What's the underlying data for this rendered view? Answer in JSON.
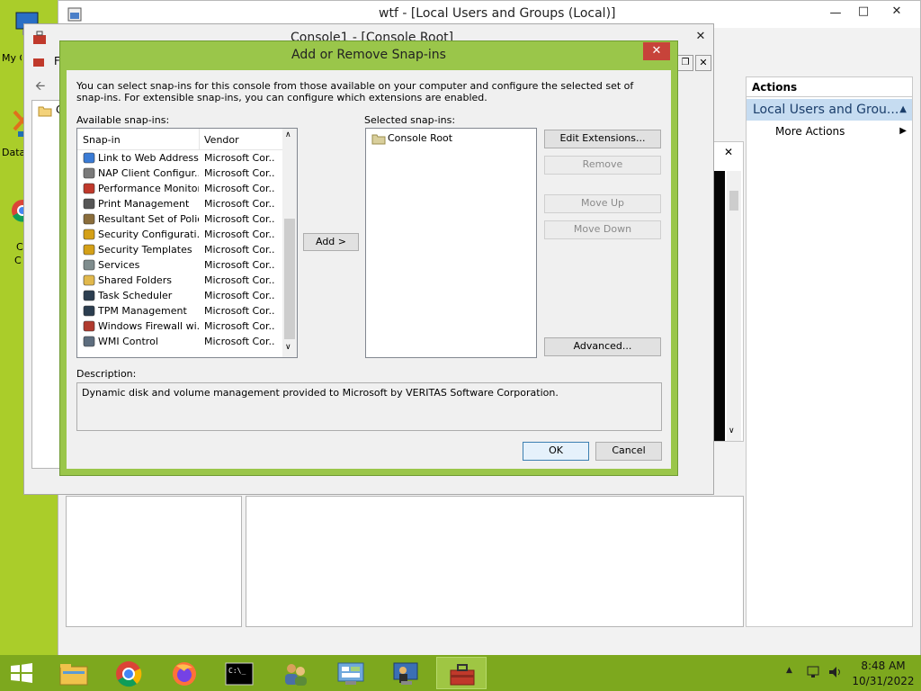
{
  "desktop": {
    "icons": [
      {
        "label": "My C",
        "icon": "computer-icon"
      },
      {
        "label": "Data",
        "icon": "tools-icon"
      },
      {
        "label": "C",
        "icon": "chrome-icon"
      },
      {
        "label": "C",
        "icon": "chrome-icon"
      }
    ]
  },
  "main_window": {
    "title": "wtf - [Local Users and Groups (Local)]",
    "actions_header": "Actions",
    "actions_section": "Local Users and Grou...",
    "more_actions": "More Actions"
  },
  "console_window": {
    "title": "Console1 - [Console Root]",
    "partial_menu": "F",
    "partial_tree": "C"
  },
  "dialog": {
    "title": "Add or Remove Snap-ins",
    "intro": "You can select snap-ins for this console from those available on your computer and configure the selected set of snap-ins. For extensible snap-ins, you can configure which extensions are enabled.",
    "available_label": "Available snap-ins:",
    "selected_label": "Selected snap-ins:",
    "columns": {
      "snapin": "Snap-in",
      "vendor": "Vendor"
    },
    "available": [
      {
        "name": "Link to Web Address",
        "vendor": "Microsoft Cor...",
        "icon": "link-icon"
      },
      {
        "name": "NAP Client Configur...",
        "vendor": "Microsoft Cor...",
        "icon": "nap-client-icon"
      },
      {
        "name": "Performance Monitor",
        "vendor": "Microsoft Cor...",
        "icon": "performance-monitor-icon"
      },
      {
        "name": "Print Management",
        "vendor": "Microsoft Cor...",
        "icon": "printer-icon"
      },
      {
        "name": "Resultant Set of Policy",
        "vendor": "Microsoft Cor...",
        "icon": "policy-icon"
      },
      {
        "name": "Security Configurati...",
        "vendor": "Microsoft Cor...",
        "icon": "security-config-icon"
      },
      {
        "name": "Security Templates",
        "vendor": "Microsoft Cor...",
        "icon": "security-templates-icon"
      },
      {
        "name": "Services",
        "vendor": "Microsoft Cor...",
        "icon": "services-gear-icon"
      },
      {
        "name": "Shared Folders",
        "vendor": "Microsoft Cor...",
        "icon": "shared-folder-icon"
      },
      {
        "name": "Task Scheduler",
        "vendor": "Microsoft Cor...",
        "icon": "clock-icon"
      },
      {
        "name": "TPM Management",
        "vendor": "Microsoft Cor...",
        "icon": "tpm-chip-icon"
      },
      {
        "name": "Windows Firewall wi...",
        "vendor": "Microsoft Cor...",
        "icon": "firewall-icon"
      },
      {
        "name": "WMI Control",
        "vendor": "Microsoft Cor...",
        "icon": "wmi-icon"
      }
    ],
    "selected": [
      {
        "name": "Console Root",
        "icon": "folder-icon"
      }
    ],
    "buttons": {
      "add": "Add >",
      "edit_extensions": "Edit Extensions...",
      "remove": "Remove",
      "move_up": "Move Up",
      "move_down": "Move Down",
      "advanced": "Advanced...",
      "ok": "OK",
      "cancel": "Cancel"
    },
    "description_label": "Description:",
    "description": "Dynamic disk and volume management provided to Microsoft by VERITAS Software Corporation."
  },
  "taskbar": {
    "items": [
      "file-explorer-icon",
      "chrome-icon",
      "firefox-icon",
      "cmd-icon",
      "users-icon",
      "control-panel-icon",
      "remote-desktop-icon",
      "toolbox-icon"
    ],
    "time": "8:48 AM",
    "date": "10/31/2022"
  },
  "colors": {
    "desktop": "#aacd2a",
    "dialog_frame": "#9ac64a",
    "taskbar": "#7da81e",
    "selection": "#cce4f7"
  }
}
